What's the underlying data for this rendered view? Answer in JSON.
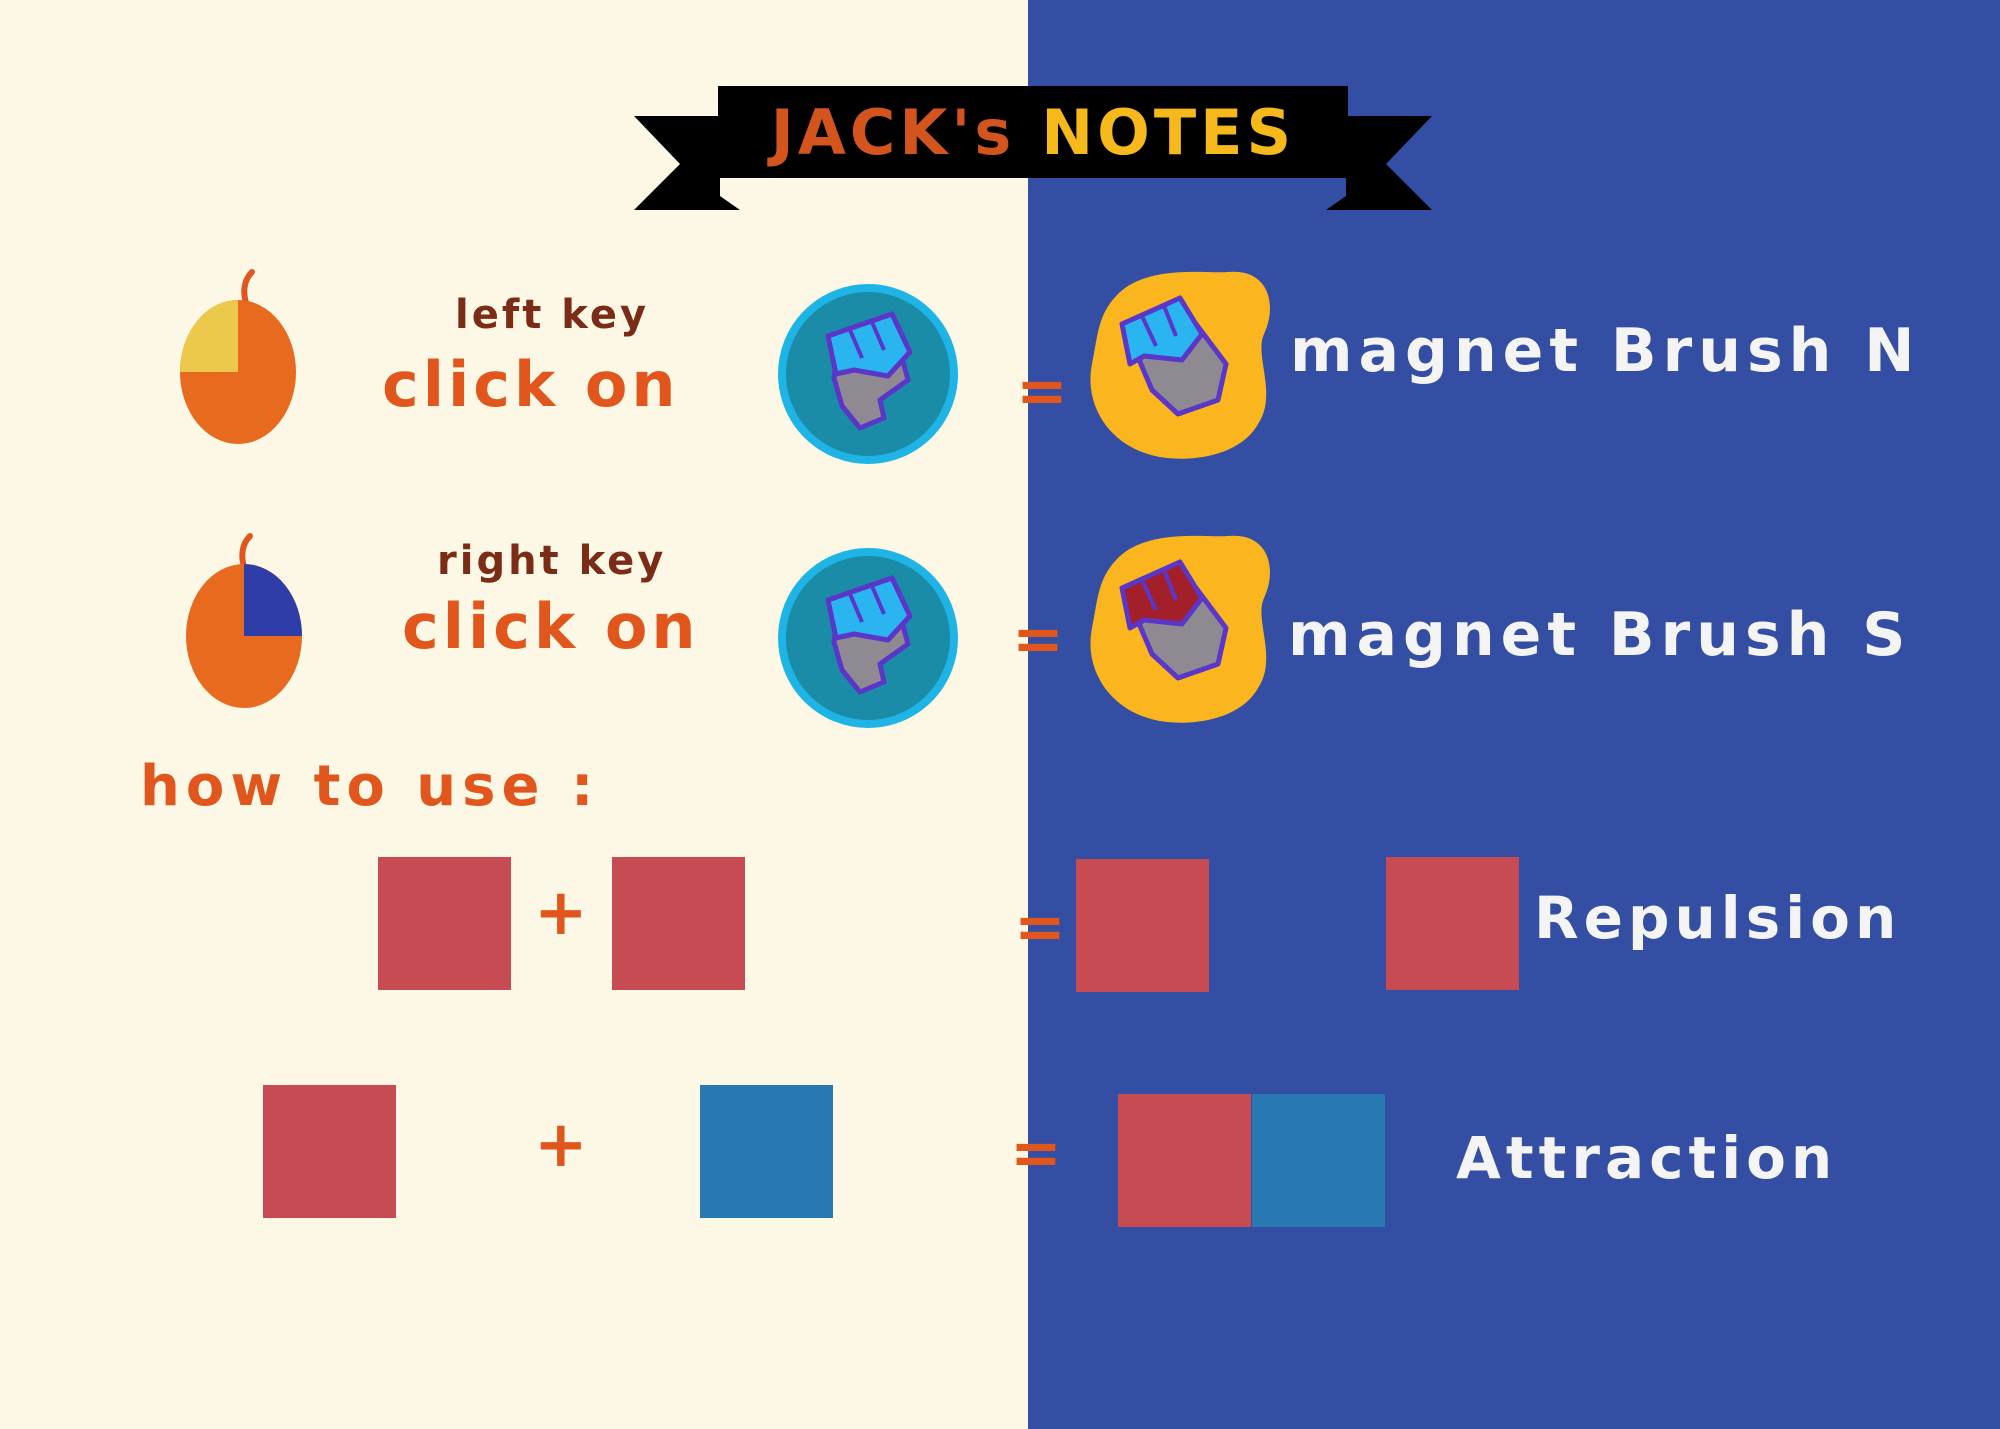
{
  "colors": {
    "left_bg": "#fdf8e6",
    "right_bg": "#334ea2",
    "orange": "#e0561c",
    "dark_brown": "#7a2c16",
    "title_left": "#d4541e",
    "title_right": "#f6b91c",
    "white": "#f4f4f4",
    "red_block": "#c74b52",
    "blue_block": "#2878b2",
    "brush_blob": "#fbb61f",
    "icon_ring": "#1fb4e6",
    "icon_fill": "#1a8ca8"
  },
  "title": {
    "part1": "JACK's",
    "part2": "NOTES"
  },
  "rows": [
    {
      "key_label": "left key",
      "action": "click on",
      "equals": "=",
      "result": "magnet Brush N",
      "mouse_button": "left"
    },
    {
      "key_label": "right key",
      "action": "click on",
      "equals": "=",
      "result": "magnet Brush S",
      "mouse_button": "right"
    }
  ],
  "how_to_use": "how to use :",
  "rules": [
    {
      "plus": "+",
      "equals": "=",
      "result": "Repulsion",
      "inputs": [
        "red",
        "red"
      ]
    },
    {
      "plus": "+",
      "equals": "=",
      "result": "Attraction",
      "inputs": [
        "red",
        "blue"
      ]
    }
  ],
  "icons": [
    "mouse-left-icon",
    "mouse-right-icon",
    "magnet-glove-icon",
    "magnet-brush-n-icon",
    "magnet-brush-s-icon"
  ]
}
